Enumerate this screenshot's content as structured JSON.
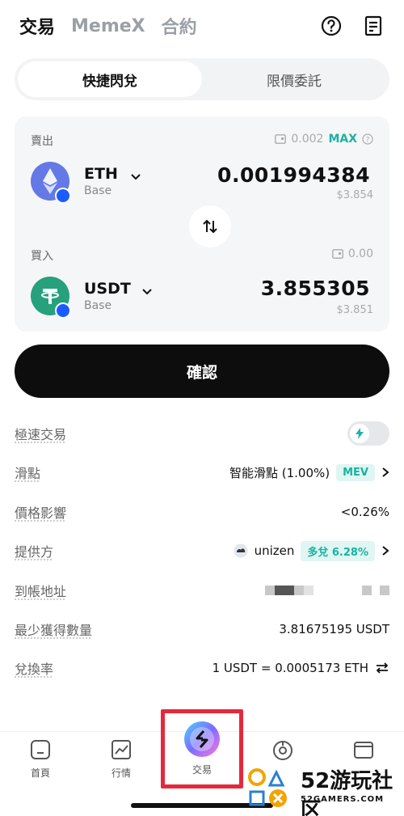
{
  "top_tabs": [
    "交易",
    "MemeX",
    "合約"
  ],
  "segment": {
    "options": [
      "快捷閃兌",
      "限價委託"
    ],
    "active": 0
  },
  "sell": {
    "label": "賣出",
    "balance": "0.002",
    "max": "MAX",
    "symbol": "ETH",
    "network": "Base",
    "amount": "0.001994384",
    "usd": "$3.854",
    "icon": "eth-icon"
  },
  "buy": {
    "label": "買入",
    "balance": "0.00",
    "symbol": "USDT",
    "network": "Base",
    "amount": "3.855305",
    "usd": "$3.851",
    "icon": "usdt-icon"
  },
  "confirm_label": "確認",
  "info": {
    "fast_trade": "極速交易",
    "slippage_label": "滑點",
    "slippage_value": "智能滑點 (1.00%)",
    "slippage_badge": "MEV",
    "price_impact_label": "價格影響",
    "price_impact_value": "<0.26%",
    "provider_label": "提供方",
    "provider_value": "unizen",
    "provider_badge": "多兌 6.28%",
    "address_label": "到帳地址",
    "min_receive_label": "最少獲得數量",
    "min_receive_value": "3.81675195 USDT",
    "rate_label": "兌換率",
    "rate_value": "1 USDT = 0.0005173 ETH"
  },
  "tabbar": [
    "首頁",
    "行情",
    "交易"
  ],
  "watermark": {
    "big": "52游玩社区",
    "small": "52GAMERS.COM"
  },
  "colors": {
    "accent": "#19b3a2",
    "highlight": "#e6283c",
    "primary_button": "#0d0d0d"
  }
}
